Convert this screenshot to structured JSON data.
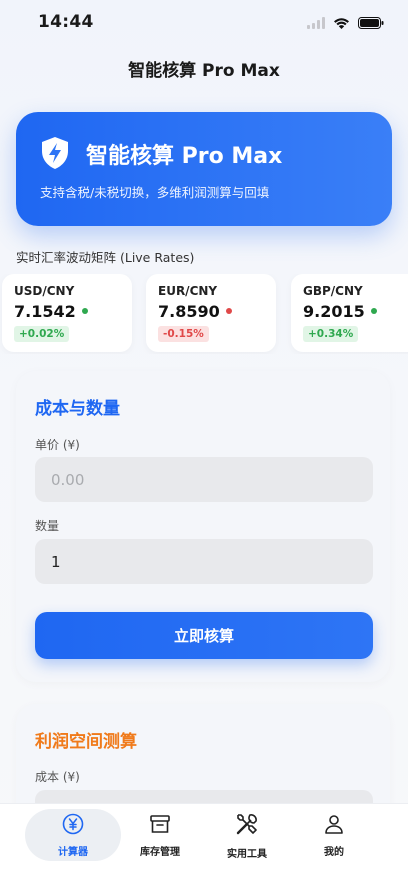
{
  "status_bar": {
    "time": "14:44"
  },
  "nav": {
    "title": "智能核算 Pro Max"
  },
  "hero": {
    "title": "智能核算 Pro Max",
    "subtitle": "支持含税/未税切换，多维利润测算与回填",
    "icon": "shield-bolt-icon"
  },
  "rates": {
    "title": "实时汇率波动矩阵 (Live Rates)",
    "items": [
      {
        "pair": "USD/CNY",
        "value": "7.1542",
        "change": "+0.02%",
        "trend": "up"
      },
      {
        "pair": "EUR/CNY",
        "value": "7.8590",
        "change": "-0.15%",
        "trend": "down"
      },
      {
        "pair": "GBP/CNY",
        "value": "9.2015",
        "change": "+0.34%",
        "trend": "up"
      }
    ]
  },
  "cost_section": {
    "title": "成本与数量",
    "unit_price_label": "单价 (¥)",
    "unit_price_placeholder": "0.00",
    "quantity_label": "数量",
    "quantity_value": "1",
    "submit_label": "立即核算"
  },
  "profit_section": {
    "title": "利润空间测算",
    "cost_label": "成本 (¥)"
  },
  "tab_bar": {
    "items": [
      {
        "label": "计算器",
        "icon": "yen-circle-icon",
        "active": true
      },
      {
        "label": "库存管理",
        "icon": "archive-box-icon",
        "active": false
      },
      {
        "label": "实用工具",
        "icon": "tools-icon",
        "active": false
      },
      {
        "label": "我的",
        "icon": "person-icon",
        "active": false
      }
    ]
  },
  "colors": {
    "primary": "#1f67f2",
    "up": "#2fa84f",
    "down": "#e04848",
    "profit_title": "#f07a1a"
  }
}
